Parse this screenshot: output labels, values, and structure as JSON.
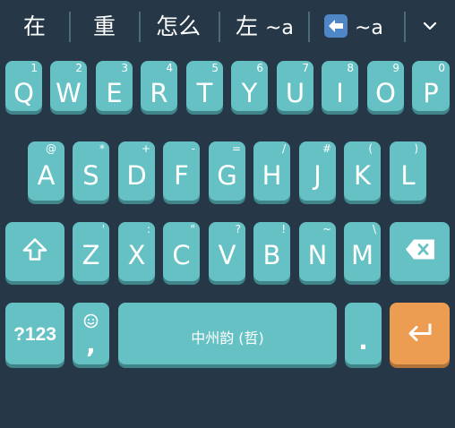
{
  "candidates": [
    {
      "text": "在"
    },
    {
      "text": "重"
    },
    {
      "text": "怎么"
    },
    {
      "text": "左",
      "suffix": "~a"
    },
    {
      "suffix": "~a",
      "icon": "left-arrow-emoji-icon"
    }
  ],
  "expand_icon": "chevron-down-icon",
  "rows": {
    "row1": [
      {
        "letter": "Q",
        "hint": "1"
      },
      {
        "letter": "W",
        "hint": "2"
      },
      {
        "letter": "E",
        "hint": "3"
      },
      {
        "letter": "R",
        "hint": "4"
      },
      {
        "letter": "T",
        "hint": "5"
      },
      {
        "letter": "Y",
        "hint": "6"
      },
      {
        "letter": "U",
        "hint": "7"
      },
      {
        "letter": "I",
        "hint": "8"
      },
      {
        "letter": "O",
        "hint": "9"
      },
      {
        "letter": "P",
        "hint": "0"
      }
    ],
    "row2": [
      {
        "letter": "A",
        "hint": "@"
      },
      {
        "letter": "S",
        "hint": "*"
      },
      {
        "letter": "D",
        "hint": "+"
      },
      {
        "letter": "F",
        "hint": "-"
      },
      {
        "letter": "G",
        "hint": "="
      },
      {
        "letter": "H",
        "hint": "/"
      },
      {
        "letter": "J",
        "hint": "#"
      },
      {
        "letter": "K",
        "hint": "("
      },
      {
        "letter": "L",
        "hint": ")"
      }
    ],
    "row3": [
      {
        "letter": "Z",
        "hint": "'"
      },
      {
        "letter": "X",
        "hint": ":"
      },
      {
        "letter": "C",
        "hint": "\""
      },
      {
        "letter": "V",
        "hint": "?"
      },
      {
        "letter": "B",
        "hint": "!"
      },
      {
        "letter": "N",
        "hint": "~"
      },
      {
        "letter": "M",
        "hint": "\\"
      }
    ]
  },
  "shift_icon": "shift-icon",
  "backspace_icon": "backspace-icon",
  "bottom": {
    "symbols_label": "?123",
    "emoji_icon": "smiley-icon",
    "comma_label": ",",
    "space_label": "中州韵 (哲)",
    "period_label": ".",
    "enter_icon": "enter-icon"
  },
  "colors": {
    "background": "#263847",
    "key": "#66c1c5",
    "key_shadow": "#3f8589",
    "enter_key": "#ec9d51",
    "text": "#ffffff"
  }
}
